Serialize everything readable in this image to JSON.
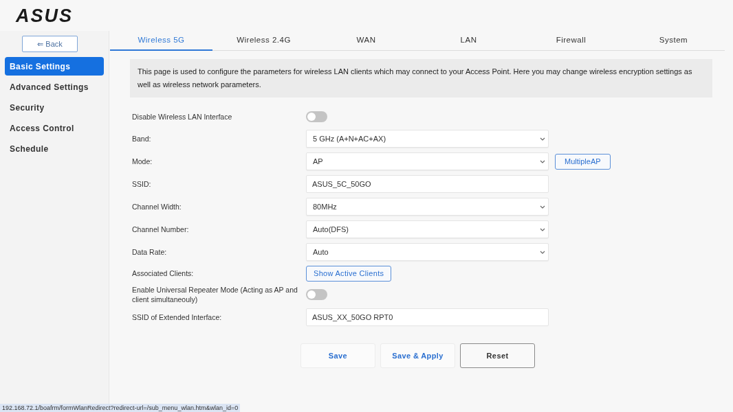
{
  "logo": "ASUS",
  "sidebar": {
    "back_button": "⇐ Back",
    "items": [
      {
        "label": "Basic Settings",
        "selected": true
      },
      {
        "label": "Advanced Settings",
        "selected": false
      },
      {
        "label": "Security",
        "selected": false
      },
      {
        "label": "Access Control",
        "selected": false
      },
      {
        "label": "Schedule",
        "selected": false
      }
    ]
  },
  "tabs": [
    {
      "label": "Wireless 5G",
      "selected": true
    },
    {
      "label": "Wireless 2.4G",
      "selected": false
    },
    {
      "label": "WAN",
      "selected": false
    },
    {
      "label": "LAN",
      "selected": false
    },
    {
      "label": "Firewall",
      "selected": false
    },
    {
      "label": "System",
      "selected": false
    }
  ],
  "description": "This page is used to configure the parameters for wireless LAN clients which may connect to your Access Point. Here you may change wireless encryption settings as well as wireless network parameters.",
  "form": {
    "rows": [
      {
        "label": "Disable Wireless LAN Interface",
        "kind": "toggle",
        "on": false
      },
      {
        "label": "Band:",
        "kind": "select",
        "value": "5 GHz (A+N+AC+AX)"
      },
      {
        "label": "Mode:",
        "kind": "select",
        "value": "AP",
        "button": "MultipleAP"
      },
      {
        "label": "SSID:",
        "kind": "text",
        "value": "ASUS_5C_50GO"
      },
      {
        "label": "Channel Width:",
        "kind": "select",
        "value": "80MHz"
      },
      {
        "label": "Channel Number:",
        "kind": "select",
        "value": "Auto(DFS)"
      },
      {
        "label": "Data Rate:",
        "kind": "select",
        "value": "Auto"
      },
      {
        "label": "Associated Clients:",
        "kind": "button",
        "value": "Show Active Clients"
      },
      {
        "label": "Enable Universal Repeater Mode (Acting as AP and client simultaneouly)",
        "kind": "toggle",
        "on": false
      },
      {
        "label": "SSID of Extended Interface:",
        "kind": "text",
        "value": "ASUS_XX_50GO RPT0"
      }
    ]
  },
  "actions": [
    {
      "label": "Save",
      "kind": "primary"
    },
    {
      "label": "Save & Apply",
      "kind": "primary"
    },
    {
      "label": "Reset",
      "kind": "secondary"
    }
  ],
  "status_bar": {
    "url": "192.168.72.1/boafrm/formWlanRedirect?redirect-url=/sub_menu_wlan.htm&wlan_id=0"
  }
}
